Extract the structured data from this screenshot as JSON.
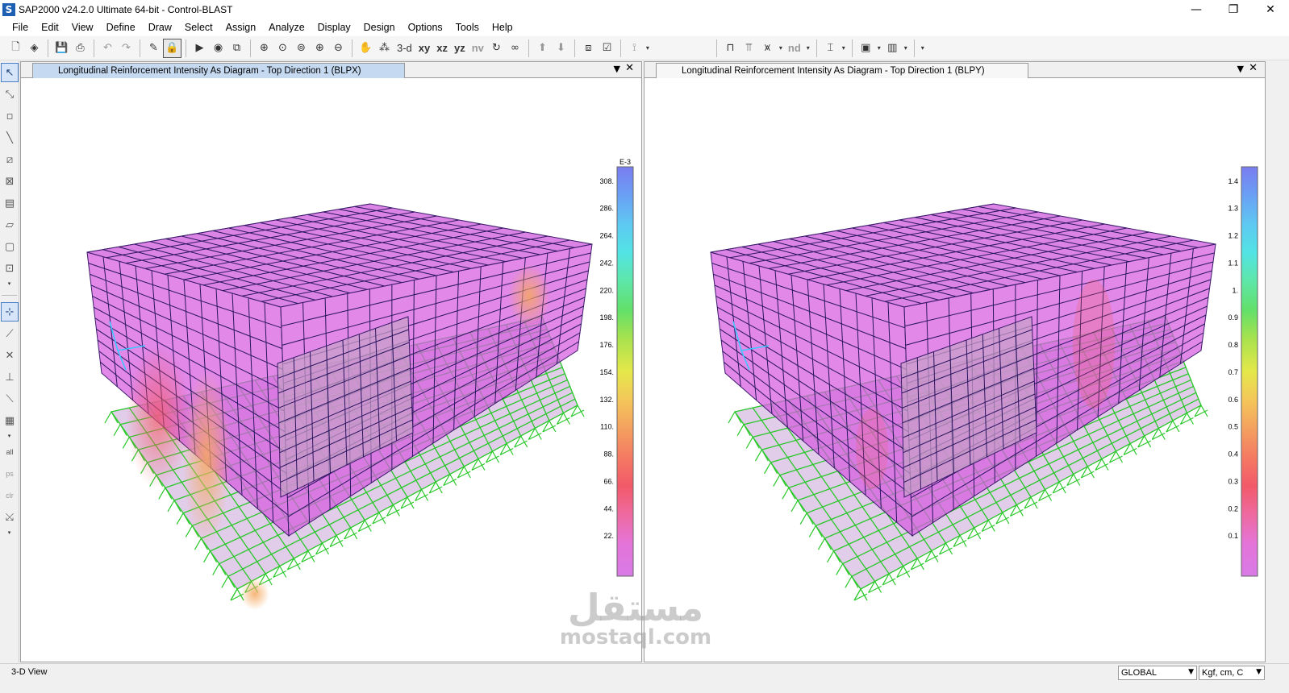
{
  "window": {
    "app_icon": "S",
    "title": "SAP2000 v24.2.0 Ultimate 64-bit - Control-BLAST",
    "minimize_icon": "—",
    "restore_icon": "❐",
    "close_icon": "✕"
  },
  "menu": [
    "File",
    "Edit",
    "View",
    "Define",
    "Draw",
    "Select",
    "Assign",
    "Analyze",
    "Display",
    "Design",
    "Options",
    "Tools",
    "Help"
  ],
  "toolbar_text": {
    "view_3d": "3-d",
    "view_xy": "xy",
    "view_xz": "xz",
    "view_yz": "yz",
    "view_nv": "nv",
    "nd": "nd"
  },
  "left_tools_text": {
    "select_all": "all",
    "previous_selection": "ps",
    "clear_selection": "clr"
  },
  "panes": [
    {
      "tab_title": "Longitudinal Reinforcement Intensity As Diagram - Top Direction 1   (BLPX)",
      "legend_unit": "E-3",
      "legend_ticks": [
        "308.",
        "286.",
        "264.",
        "242.",
        "220.",
        "198.",
        "176.",
        "154.",
        "132.",
        "110.",
        "88.",
        "66.",
        "44.",
        "22."
      ]
    },
    {
      "tab_title": "Longitudinal Reinforcement Intensity As Diagram - Top Direction 1   (BLPY)",
      "legend_unit": "",
      "legend_ticks": [
        "1.4",
        "1.3",
        "1.2",
        "1.1",
        "1.",
        "0.9",
        "0.8",
        "0.7",
        "0.6",
        "0.5",
        "0.4",
        "0.3",
        "0.2",
        "0.1"
      ]
    }
  ],
  "legend_colors": [
    "#7a7cf0",
    "#6aa0f4",
    "#5ec8f2",
    "#52e4e4",
    "#5ee6a8",
    "#62e06a",
    "#a8e24e",
    "#e4e84a",
    "#f4c65a",
    "#f4a060",
    "#f47a62",
    "#f25a6a",
    "#ee6aa0",
    "#e474d8",
    "#d87ae6"
  ],
  "watermark": {
    "arabic": "مستقل",
    "latin": "mostaql.com"
  },
  "status": {
    "view_name": "3-D View",
    "coord_system": "GLOBAL",
    "units": "Kgf, cm, C"
  }
}
